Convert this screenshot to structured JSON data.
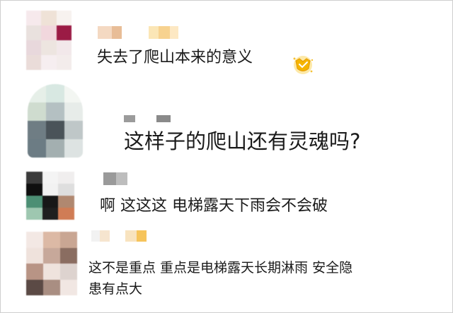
{
  "comments": [
    {
      "text": "失去了爬山本来的意义",
      "avatar_colors": [
        "#f6e9ec",
        "#efe2d7",
        "#f7f2ef",
        "#e9e1de",
        "#f1d7dd",
        "#9b1b45",
        "#e8d8dc",
        "#ede5e0",
        "#f2e8ea",
        "#eadcd9",
        "#f6eef0",
        "#f3eceb"
      ],
      "name_colors": [
        "#f4d9c2",
        "#e8bd97",
        "#ffffff",
        "#ffffff",
        "#fbe6b6",
        "#f7d28f",
        "#fde8c3"
      ],
      "badge": "medal-icon"
    },
    {
      "text": "这样子的爬山还有灵魂吗?",
      "avatar_colors": [
        "#e6efe8",
        "#d8e8e2",
        "#f3f6f2",
        "#cfdccf",
        "#b4c0c2",
        "#e7ece9",
        "#6f7d84",
        "#4a5359",
        "#bfc7c8",
        "#6c7c84",
        "#a3afb0",
        "#dde3e2"
      ],
      "name_colors": [
        "#9b9b9b",
        "#ffffff",
        "#8a8a8a"
      ]
    },
    {
      "text": "啊 这这这 电梯露天下雨会不会破",
      "avatar_colors": [
        "#3b3b3b",
        "#f4f4f4",
        "#f0eeee",
        "#0f0f0f",
        "#f2f2f2",
        "#dedede",
        "#4c8f74",
        "#171717",
        "#b08870",
        "#9ec7b0",
        "#1f1f1f",
        "#d07c55"
      ],
      "name_colors": [
        "#9a9a9a",
        "#bdbdbd",
        "#ffffff"
      ]
    },
    {
      "text_lines": [
        "这不是重点 重点是电梯露天长期淋雨 安全隐",
        "患有点大"
      ],
      "avatar_colors": [
        "#f3e8e4",
        "#dcb9a5",
        "#c9a693",
        "#efe2dc",
        "#c7a89a",
        "#8a6d61",
        "#b89485",
        "#efe3dd",
        "#ddd3cf",
        "#5b4a45",
        "#a98e82",
        "#f1e7e3"
      ],
      "name_colors": [
        "#f2f2f2",
        "#f6e5cf",
        "#ffffff",
        "#f8e3bf",
        "#f6c45b"
      ]
    }
  ]
}
